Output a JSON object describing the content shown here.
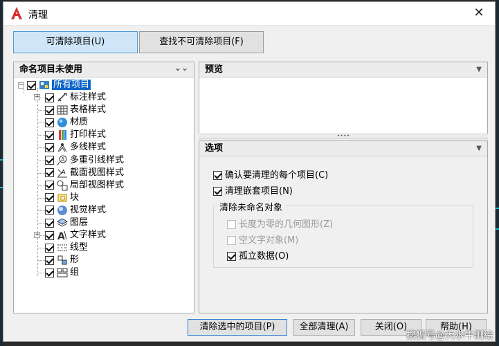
{
  "window": {
    "title": "清理",
    "close_glyph": "✕"
  },
  "tabs": [
    {
      "label": "可清除项目(U)",
      "active": true
    },
    {
      "label": "查找不可清除项目(F)",
      "active": false
    }
  ],
  "named_panel": {
    "title": "命名项目未使用",
    "collapse_glyph": "⌄⌄",
    "root": {
      "label": "所有项目",
      "checked": true,
      "expanded": true
    },
    "items": [
      {
        "label": "标注样式",
        "checked": true,
        "expandable": true,
        "icon": "dimension-style-icon"
      },
      {
        "label": "表格样式",
        "checked": true,
        "expandable": false,
        "icon": "table-style-icon"
      },
      {
        "label": "材质",
        "checked": true,
        "expandable": false,
        "icon": "material-icon"
      },
      {
        "label": "打印样式",
        "checked": true,
        "expandable": false,
        "icon": "plot-style-icon"
      },
      {
        "label": "多线样式",
        "checked": true,
        "expandable": false,
        "icon": "multiline-style-icon"
      },
      {
        "label": "多重引线样式",
        "checked": true,
        "expandable": false,
        "icon": "mleader-style-icon"
      },
      {
        "label": "截面视图样式",
        "checked": true,
        "expandable": false,
        "icon": "section-view-style-icon"
      },
      {
        "label": "局部视图样式",
        "checked": true,
        "expandable": false,
        "icon": "detail-view-style-icon"
      },
      {
        "label": "块",
        "checked": true,
        "expandable": false,
        "icon": "block-icon"
      },
      {
        "label": "视觉样式",
        "checked": true,
        "expandable": false,
        "icon": "visual-style-icon"
      },
      {
        "label": "图层",
        "checked": true,
        "expandable": false,
        "icon": "layer-icon"
      },
      {
        "label": "文字样式",
        "checked": true,
        "expandable": true,
        "icon": "text-style-icon"
      },
      {
        "label": "线型",
        "checked": true,
        "expandable": false,
        "icon": "linetype-icon"
      },
      {
        "label": "形",
        "checked": true,
        "expandable": false,
        "icon": "shape-icon"
      },
      {
        "label": "组",
        "checked": true,
        "expandable": false,
        "icon": "group-icon"
      }
    ]
  },
  "preview_panel": {
    "title": "预览"
  },
  "options_panel": {
    "title": "选项",
    "confirm_each": {
      "label": "确认要清理的每个项目(C)",
      "checked": true
    },
    "purge_nested": {
      "label": "清理嵌套项目(N)",
      "checked": true
    },
    "unnamed_group": {
      "title": "清除未命名对象",
      "zero_length": {
        "label": "长度为零的几何图形(Z)",
        "checked": false,
        "enabled": false
      },
      "empty_text": {
        "label": "空文字对象(M)",
        "checked": false,
        "enabled": false
      },
      "orphaned_data": {
        "label": "孤立数据(O)",
        "checked": true,
        "enabled": true
      }
    }
  },
  "buttons": {
    "purge_selected": "清除选中的项目(P)",
    "purge_all": "全部清理(A)",
    "close": "关闭(O)",
    "help": "帮助(H)"
  },
  "watermark": "搜狐号@大水牛测绘",
  "colors": {
    "selection": "#0a64c8",
    "active_tab": "#cfe6f8",
    "app_icon": "#d32f2f"
  }
}
